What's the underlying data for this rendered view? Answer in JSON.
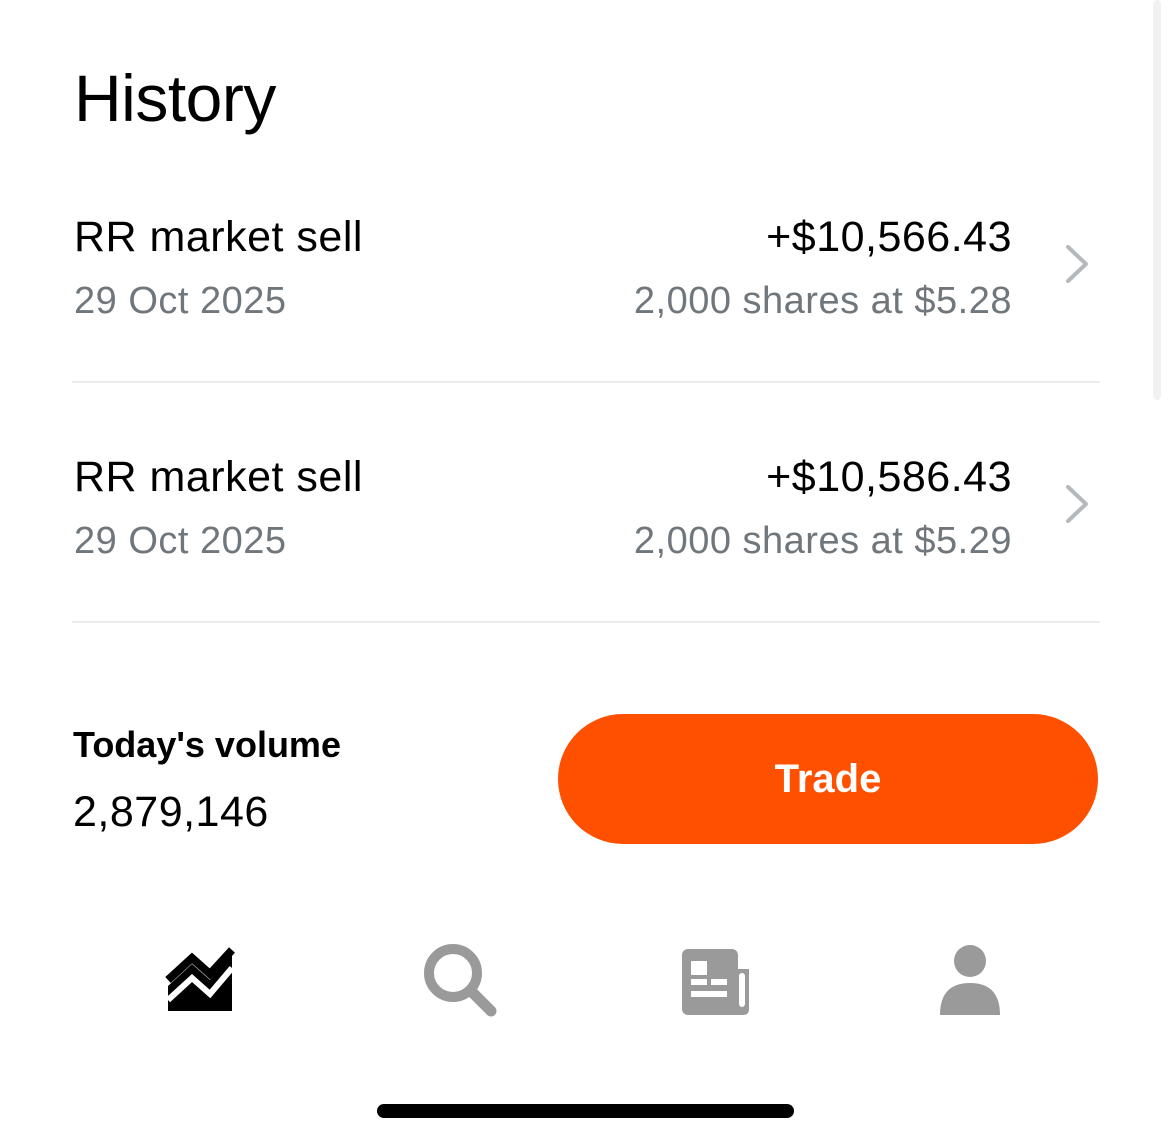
{
  "header": {
    "title": "History"
  },
  "transactions": [
    {
      "title": "RR market sell",
      "date": "29 Oct 2025",
      "amount": "+$10,566.43",
      "detail": "2,000 shares at $5.28"
    },
    {
      "title": "RR market sell",
      "date": "29 Oct 2025",
      "amount": "+$10,586.43",
      "detail": "2,000 shares at $5.29"
    }
  ],
  "volume": {
    "label": "Today's volume",
    "value": "2,879,146"
  },
  "trade_button": {
    "label": "Trade",
    "color": "#ff5000"
  },
  "tab_bar": {
    "active_color": "#000000",
    "inactive_color": "#9a9a9a",
    "tabs": [
      {
        "icon": "chart-icon",
        "active": true
      },
      {
        "icon": "search-icon",
        "active": false
      },
      {
        "icon": "news-icon",
        "active": false
      },
      {
        "icon": "profile-icon",
        "active": false
      }
    ]
  }
}
